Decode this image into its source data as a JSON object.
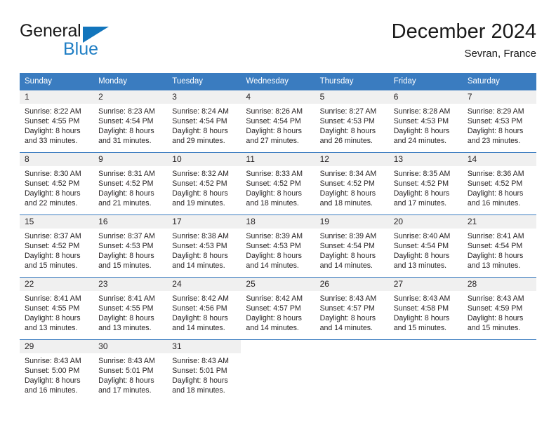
{
  "brand": {
    "name_part1": "General",
    "name_part2": "Blue",
    "triangle_color": "#1275bc",
    "blue_color": "#1f7ec4"
  },
  "header": {
    "title": "December 2024",
    "subtitle": "Sevran, France"
  },
  "theme": {
    "header_bg": "#3a7cc0",
    "daynum_bg": "#f0f0f0",
    "text": "#231f20"
  },
  "calendar": {
    "weekday_headers": [
      "Sunday",
      "Monday",
      "Tuesday",
      "Wednesday",
      "Thursday",
      "Friday",
      "Saturday"
    ],
    "weeks": [
      [
        {
          "day": "1",
          "sunrise": "Sunrise: 8:22 AM",
          "sunset": "Sunset: 4:55 PM",
          "daylight1": "Daylight: 8 hours",
          "daylight2": "and 33 minutes."
        },
        {
          "day": "2",
          "sunrise": "Sunrise: 8:23 AM",
          "sunset": "Sunset: 4:54 PM",
          "daylight1": "Daylight: 8 hours",
          "daylight2": "and 31 minutes."
        },
        {
          "day": "3",
          "sunrise": "Sunrise: 8:24 AM",
          "sunset": "Sunset: 4:54 PM",
          "daylight1": "Daylight: 8 hours",
          "daylight2": "and 29 minutes."
        },
        {
          "day": "4",
          "sunrise": "Sunrise: 8:26 AM",
          "sunset": "Sunset: 4:54 PM",
          "daylight1": "Daylight: 8 hours",
          "daylight2": "and 27 minutes."
        },
        {
          "day": "5",
          "sunrise": "Sunrise: 8:27 AM",
          "sunset": "Sunset: 4:53 PM",
          "daylight1": "Daylight: 8 hours",
          "daylight2": "and 26 minutes."
        },
        {
          "day": "6",
          "sunrise": "Sunrise: 8:28 AM",
          "sunset": "Sunset: 4:53 PM",
          "daylight1": "Daylight: 8 hours",
          "daylight2": "and 24 minutes."
        },
        {
          "day": "7",
          "sunrise": "Sunrise: 8:29 AM",
          "sunset": "Sunset: 4:53 PM",
          "daylight1": "Daylight: 8 hours",
          "daylight2": "and 23 minutes."
        }
      ],
      [
        {
          "day": "8",
          "sunrise": "Sunrise: 8:30 AM",
          "sunset": "Sunset: 4:52 PM",
          "daylight1": "Daylight: 8 hours",
          "daylight2": "and 22 minutes."
        },
        {
          "day": "9",
          "sunrise": "Sunrise: 8:31 AM",
          "sunset": "Sunset: 4:52 PM",
          "daylight1": "Daylight: 8 hours",
          "daylight2": "and 21 minutes."
        },
        {
          "day": "10",
          "sunrise": "Sunrise: 8:32 AM",
          "sunset": "Sunset: 4:52 PM",
          "daylight1": "Daylight: 8 hours",
          "daylight2": "and 19 minutes."
        },
        {
          "day": "11",
          "sunrise": "Sunrise: 8:33 AM",
          "sunset": "Sunset: 4:52 PM",
          "daylight1": "Daylight: 8 hours",
          "daylight2": "and 18 minutes."
        },
        {
          "day": "12",
          "sunrise": "Sunrise: 8:34 AM",
          "sunset": "Sunset: 4:52 PM",
          "daylight1": "Daylight: 8 hours",
          "daylight2": "and 18 minutes."
        },
        {
          "day": "13",
          "sunrise": "Sunrise: 8:35 AM",
          "sunset": "Sunset: 4:52 PM",
          "daylight1": "Daylight: 8 hours",
          "daylight2": "and 17 minutes."
        },
        {
          "day": "14",
          "sunrise": "Sunrise: 8:36 AM",
          "sunset": "Sunset: 4:52 PM",
          "daylight1": "Daylight: 8 hours",
          "daylight2": "and 16 minutes."
        }
      ],
      [
        {
          "day": "15",
          "sunrise": "Sunrise: 8:37 AM",
          "sunset": "Sunset: 4:52 PM",
          "daylight1": "Daylight: 8 hours",
          "daylight2": "and 15 minutes."
        },
        {
          "day": "16",
          "sunrise": "Sunrise: 8:37 AM",
          "sunset": "Sunset: 4:53 PM",
          "daylight1": "Daylight: 8 hours",
          "daylight2": "and 15 minutes."
        },
        {
          "day": "17",
          "sunrise": "Sunrise: 8:38 AM",
          "sunset": "Sunset: 4:53 PM",
          "daylight1": "Daylight: 8 hours",
          "daylight2": "and 14 minutes."
        },
        {
          "day": "18",
          "sunrise": "Sunrise: 8:39 AM",
          "sunset": "Sunset: 4:53 PM",
          "daylight1": "Daylight: 8 hours",
          "daylight2": "and 14 minutes."
        },
        {
          "day": "19",
          "sunrise": "Sunrise: 8:39 AM",
          "sunset": "Sunset: 4:54 PM",
          "daylight1": "Daylight: 8 hours",
          "daylight2": "and 14 minutes."
        },
        {
          "day": "20",
          "sunrise": "Sunrise: 8:40 AM",
          "sunset": "Sunset: 4:54 PM",
          "daylight1": "Daylight: 8 hours",
          "daylight2": "and 13 minutes."
        },
        {
          "day": "21",
          "sunrise": "Sunrise: 8:41 AM",
          "sunset": "Sunset: 4:54 PM",
          "daylight1": "Daylight: 8 hours",
          "daylight2": "and 13 minutes."
        }
      ],
      [
        {
          "day": "22",
          "sunrise": "Sunrise: 8:41 AM",
          "sunset": "Sunset: 4:55 PM",
          "daylight1": "Daylight: 8 hours",
          "daylight2": "and 13 minutes."
        },
        {
          "day": "23",
          "sunrise": "Sunrise: 8:41 AM",
          "sunset": "Sunset: 4:55 PM",
          "daylight1": "Daylight: 8 hours",
          "daylight2": "and 13 minutes."
        },
        {
          "day": "24",
          "sunrise": "Sunrise: 8:42 AM",
          "sunset": "Sunset: 4:56 PM",
          "daylight1": "Daylight: 8 hours",
          "daylight2": "and 14 minutes."
        },
        {
          "day": "25",
          "sunrise": "Sunrise: 8:42 AM",
          "sunset": "Sunset: 4:57 PM",
          "daylight1": "Daylight: 8 hours",
          "daylight2": "and 14 minutes."
        },
        {
          "day": "26",
          "sunrise": "Sunrise: 8:43 AM",
          "sunset": "Sunset: 4:57 PM",
          "daylight1": "Daylight: 8 hours",
          "daylight2": "and 14 minutes."
        },
        {
          "day": "27",
          "sunrise": "Sunrise: 8:43 AM",
          "sunset": "Sunset: 4:58 PM",
          "daylight1": "Daylight: 8 hours",
          "daylight2": "and 15 minutes."
        },
        {
          "day": "28",
          "sunrise": "Sunrise: 8:43 AM",
          "sunset": "Sunset: 4:59 PM",
          "daylight1": "Daylight: 8 hours",
          "daylight2": "and 15 minutes."
        }
      ],
      [
        {
          "day": "29",
          "sunrise": "Sunrise: 8:43 AM",
          "sunset": "Sunset: 5:00 PM",
          "daylight1": "Daylight: 8 hours",
          "daylight2": "and 16 minutes."
        },
        {
          "day": "30",
          "sunrise": "Sunrise: 8:43 AM",
          "sunset": "Sunset: 5:01 PM",
          "daylight1": "Daylight: 8 hours",
          "daylight2": "and 17 minutes."
        },
        {
          "day": "31",
          "sunrise": "Sunrise: 8:43 AM",
          "sunset": "Sunset: 5:01 PM",
          "daylight1": "Daylight: 8 hours",
          "daylight2": "and 18 minutes."
        },
        {
          "day": "",
          "sunrise": "",
          "sunset": "",
          "daylight1": "",
          "daylight2": ""
        },
        {
          "day": "",
          "sunrise": "",
          "sunset": "",
          "daylight1": "",
          "daylight2": ""
        },
        {
          "day": "",
          "sunrise": "",
          "sunset": "",
          "daylight1": "",
          "daylight2": ""
        },
        {
          "day": "",
          "sunrise": "",
          "sunset": "",
          "daylight1": "",
          "daylight2": ""
        }
      ]
    ]
  }
}
